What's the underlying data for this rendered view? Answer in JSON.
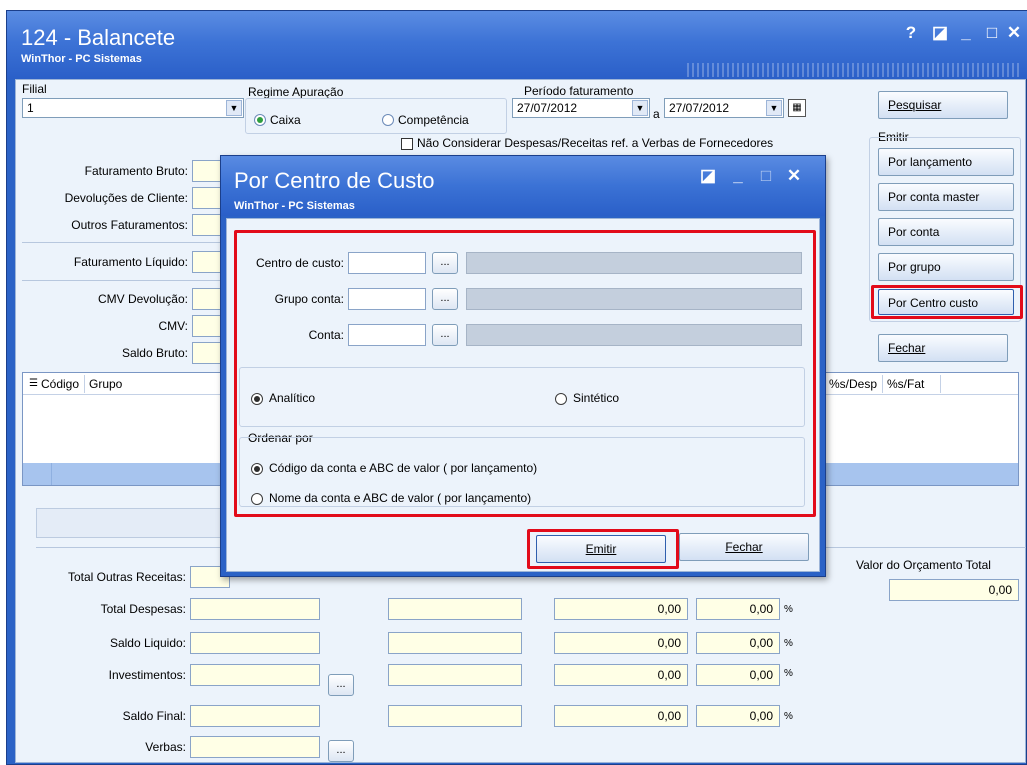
{
  "window": {
    "title": "124 - Balancete",
    "subtitle": "WinThor - PC Sistemas",
    "controls": [
      "?",
      "◪",
      "_",
      "□",
      "✕"
    ]
  },
  "filters": {
    "filial_label": "Filial",
    "filial_value": "1",
    "regime_label": "Regime Apuração",
    "regime_caixa": "Caixa",
    "regime_competencia": "Competência",
    "periodo_label": "Período faturamento",
    "date_from": "27/07/2012",
    "date_sep": "a",
    "date_to": "27/07/2012",
    "nao_considerar": "Não Considerar Despesas/Receitas ref. a Verbas de Fornecedores"
  },
  "left_labels": {
    "faturamento_bruto": "Faturamento Bruto:",
    "devolucoes": "Devoluções de Cliente:",
    "outros_faturamentos": "Outros Faturamentos:",
    "faturamento_liquido": "Faturamento Líquido:",
    "cmv_devolucao": "CMV Devolução:",
    "cmv": "CMV:",
    "saldo_bruto": "Saldo Bruto:"
  },
  "grid": {
    "col_codigo": "Código",
    "col_grupo": "Grupo",
    "col_sdesp": "%s/Desp",
    "col_sfat": "%s/Fat"
  },
  "bottom": {
    "total_outras_receitas": "Total Outras Receitas:",
    "total_despesas": "Total Despesas:",
    "saldo_liquido": "Saldo Liquido:",
    "investimentos": "Investimentos:",
    "saldo_final": "Saldo Final:",
    "verbas": "Verbas:",
    "zero": "0,00",
    "pct": "%",
    "ellipsis": "..."
  },
  "right_panel": {
    "pesquisar": "Pesquisar",
    "emitir_label": "Emitir",
    "por_lancamento": "Por lançamento",
    "por_conta_master": "Por conta master",
    "por_conta": "Por conta",
    "por_grupo": "Por grupo",
    "por_centro_custo": "Por Centro custo",
    "fechar": "Fechar",
    "valor_orcamento_label": "Valor do Orçamento Total",
    "valor_orcamento": "0,00"
  },
  "dialog": {
    "title": "Por Centro de Custo",
    "subtitle": "WinThor - PC Sistemas",
    "centro_custo": "Centro de custo:",
    "grupo_conta": "Grupo conta:",
    "conta": "Conta:",
    "ellipsis": "...",
    "analitico": "Analítico",
    "sintetico": "Sintético",
    "ordenar_por": "Ordenar por",
    "ordem_1": "Código da conta e ABC de valor ( por lançamento)",
    "ordem_2": "Nome da conta e ABC de valor ( por lançamento)",
    "emitir": "Emitir",
    "fechar": "Fechar"
  },
  "colors": {
    "titlebar": "#3d73d6",
    "highlight": "#e20b1a",
    "field_yellow": "#ffffe6",
    "client_bg": "#ecf3fb"
  }
}
